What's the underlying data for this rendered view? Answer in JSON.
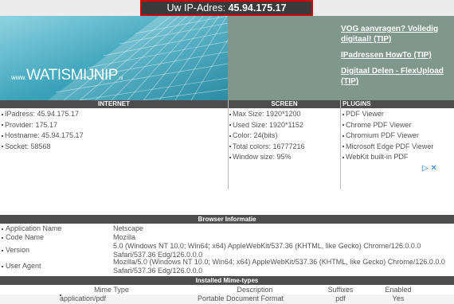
{
  "banner": {
    "prefix": "Uw IP-Adres:",
    "ip": "45.94.175.17"
  },
  "logo": {
    "www": "www.",
    "name": "WATISMIJNIP",
    "tld": ".nl"
  },
  "links": [
    "VOG aanvragen? Volledig digitaal! (TIP)",
    "IPadressen HowTo (TIP)",
    "Digitaal Delen - FlexUpload (TIP)"
  ],
  "sections": {
    "internet": "INTERNET",
    "screen": "SCREEN",
    "plugins": "PLUGINS"
  },
  "internet": [
    "IPadress: 45.94.175.17",
    "Provider: 175.17",
    "Hostname: 45.94.175.17",
    "Socket: 58568"
  ],
  "screen": [
    "Max Size: 1920*1200",
    "Used Size: 1920*1152",
    "Color: 24(bits)",
    "Total colors: 16777216",
    "Window size: 95%"
  ],
  "plugins": [
    "PDF Viewer",
    "Chrome PDF Viewer",
    "Chromium PDF Viewer",
    "Microsoft Edge PDF Viewer",
    "WebKit built-in PDF"
  ],
  "ad_icons": "▷ ✕",
  "browser": {
    "title": "Browser Informatie",
    "rows": [
      {
        "key": "Application Name",
        "value": "Netscape"
      },
      {
        "key": "Code Name",
        "value": "Mozilla"
      },
      {
        "key": "Version",
        "value": "5.0 (Windows NT 10.0; Win64; x64) AppleWebKit/537.36 (KHTML, like Gecko) Chrome/126.0.0.0 Safari/537.36 Edg/126.0.0.0"
      },
      {
        "key": "User Agent",
        "value": "Mozilla/5.0 (Windows NT 10.0; Win64; x64) AppleWebKit/537.36 (KHTML, like Gecko) Chrome/126.0.0.0 Safari/537.36 Edg/126.0.0.0"
      }
    ]
  },
  "mime": {
    "title": "Installed Mime-types",
    "columns": [
      "Mime Type",
      "Description",
      "Suffixes",
      "Enabled"
    ],
    "rows": [
      {
        "type": "application/pdf",
        "description": "Portable Document Format",
        "suffix": "pdf",
        "enabled": "Yes"
      }
    ]
  }
}
